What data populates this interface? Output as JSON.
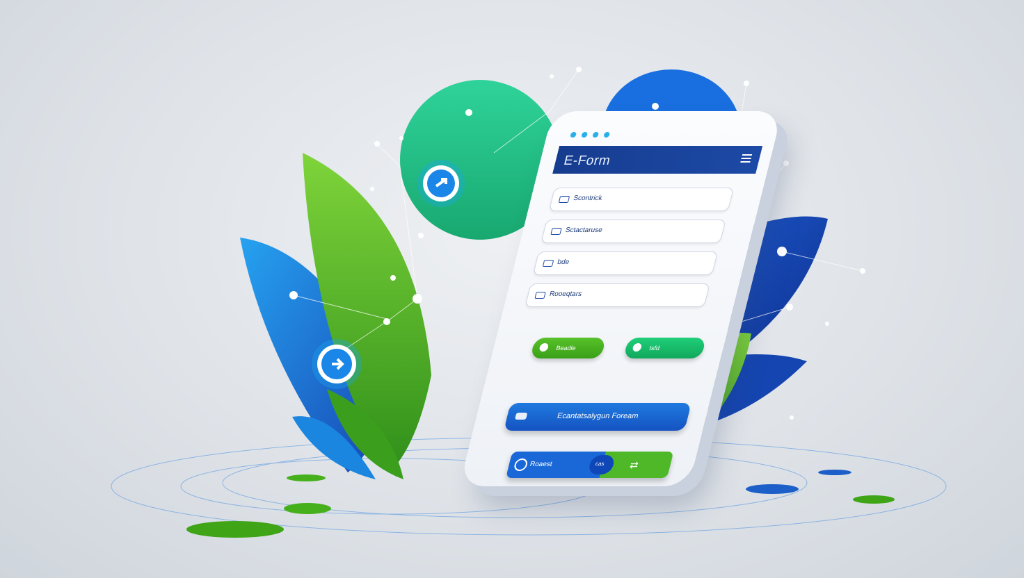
{
  "colors": {
    "navy": "#163c8f",
    "blue": "#1a68d8",
    "sky": "#2ab0e8",
    "green": "#4fb829",
    "teal": "#1fcf78"
  },
  "app": {
    "title": "E-Form",
    "menu_icon": "menu-icon"
  },
  "fields": [
    {
      "label": "Scontrick",
      "icon": "card-icon"
    },
    {
      "label": "Sctactaruse",
      "icon": "card-icon"
    },
    {
      "label": "bde",
      "icon": "card-icon"
    },
    {
      "label": "Rooeqtars",
      "icon": "card-icon"
    }
  ],
  "buttons": {
    "left_pill": "Beadle",
    "right_pill": "tsfd",
    "wide": "Ecantatsalygun Foream",
    "bottom_left": "Roaest",
    "bottom_toggle": "cas"
  }
}
